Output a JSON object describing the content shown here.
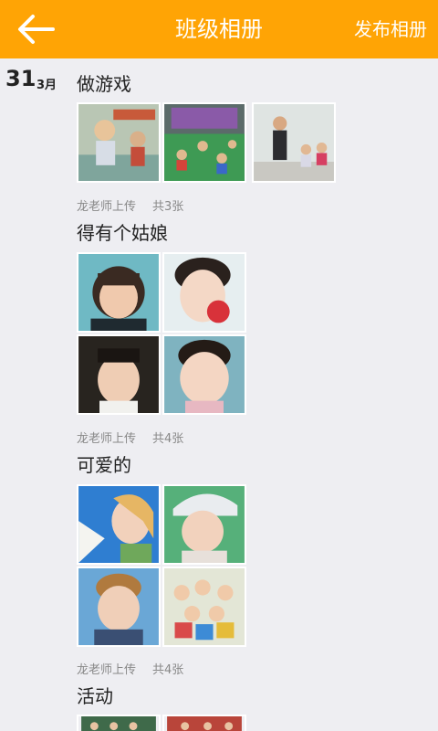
{
  "header": {
    "title": "班级相册",
    "publish_label": "发布相册",
    "back_icon": "arrow-left-icon"
  },
  "date": {
    "day": "31",
    "month": "3月"
  },
  "albums": [
    {
      "title": "做游戏",
      "uploader": "龙老师上传",
      "count": "共3张"
    },
    {
      "title": "得有个姑娘",
      "uploader": "龙老师上传",
      "count": "共4张"
    },
    {
      "title": "可爱的",
      "uploader": "龙老师上传",
      "count": "共4张"
    },
    {
      "title": "活动"
    }
  ],
  "colors": {
    "accent": "#ffa405",
    "background": "#eeeef2",
    "meta_text": "#888888"
  }
}
